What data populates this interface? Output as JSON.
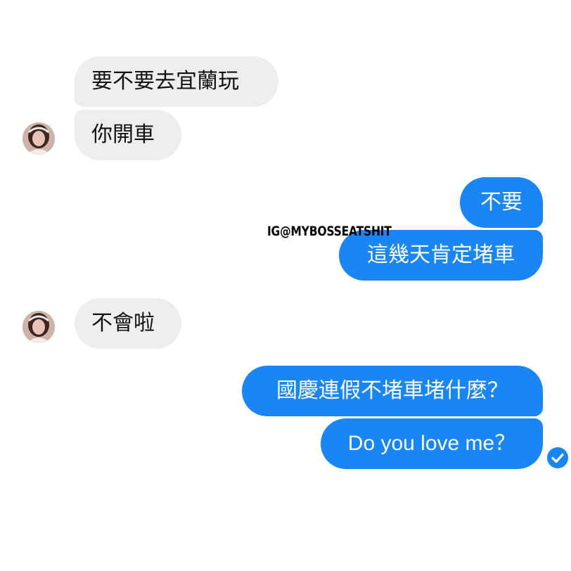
{
  "conversation": {
    "received_1": {
      "line_1": "要不要去宜蘭玩",
      "line_2": "你開車"
    },
    "sent_1": {
      "line_1": "不要",
      "line_2": "這幾天肯定堵車"
    },
    "received_2": {
      "line_1": "不會啦"
    },
    "sent_2": {
      "line_1": "國慶連假不堵車堵什麼？",
      "line_2": "Do you love me？"
    }
  },
  "watermark": "IG@MYBOSSEATSHIT",
  "icons": {
    "avatar": "contact-avatar-icon",
    "read_receipt": "check-circle-icon"
  },
  "colors": {
    "sent_bubble": "#1a86f6",
    "received_bubble": "#eeeeef",
    "received_text": "#111111",
    "sent_text": "#ffffff"
  }
}
